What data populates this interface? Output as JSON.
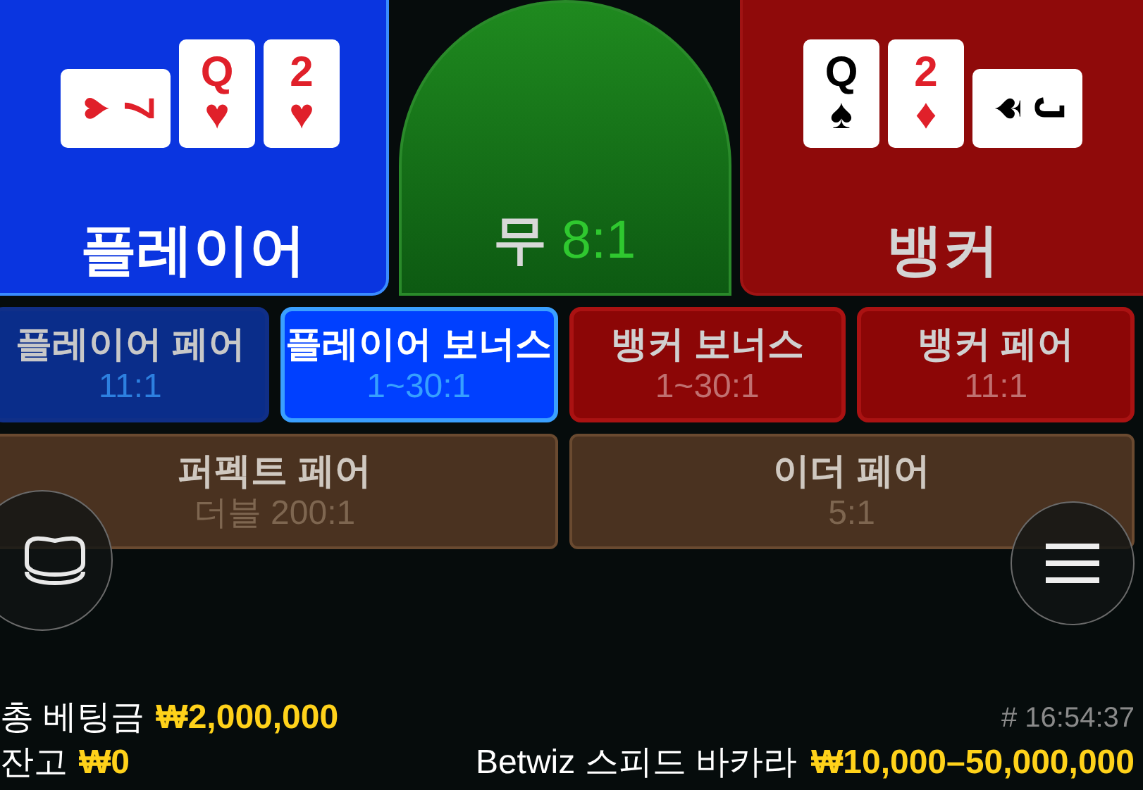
{
  "main_bets": [
    {
      "kind": "player",
      "label": "플레이어",
      "cards": [
        {
          "rank": "7",
          "suit": "♥",
          "color": "#e0202a",
          "sideways": true
        },
        {
          "rank": "Q",
          "suit": "♥",
          "color": "#e0202a",
          "sideways": false
        },
        {
          "rank": "2",
          "suit": "♥",
          "color": "#e0202a",
          "sideways": false
        }
      ]
    },
    {
      "kind": "tie",
      "label": "무",
      "odds": "8:1"
    },
    {
      "kind": "banker",
      "label": "뱅커",
      "cards": [
        {
          "rank": "Q",
          "suit": "♠",
          "color": "#000000",
          "sideways": false
        },
        {
          "rank": "2",
          "suit": "♦",
          "color": "#e0202a",
          "sideways": false
        },
        {
          "rank": "J",
          "suit": "♠",
          "color": "#000000",
          "sideways": true
        }
      ]
    }
  ],
  "side_bets": [
    {
      "kind": "player",
      "label": "플레이어 페어",
      "odds": "11:1",
      "selected": false
    },
    {
      "kind": "player",
      "label": "플레이어 보너스",
      "odds": "1~30:1",
      "selected": true
    },
    {
      "kind": "banker",
      "label": "뱅커 보너스",
      "odds": "1~30:1",
      "selected": false
    },
    {
      "kind": "banker",
      "label": "뱅커 페어",
      "odds": "11:1",
      "selected": false
    }
  ],
  "extra_bets": [
    {
      "label": "퍼펙트 페어",
      "odds": "더블 200:1"
    },
    {
      "label": "이더 페어",
      "odds": "5:1"
    }
  ],
  "footer": {
    "total_bet_label": "총 베팅금",
    "total_bet": "₩2,000,000",
    "balance_label": "잔고",
    "balance": "₩0",
    "time": "# 16:54:37",
    "table_name": "Betwiz 스피드 바카라",
    "limits": "₩10,000–50,000,000"
  }
}
